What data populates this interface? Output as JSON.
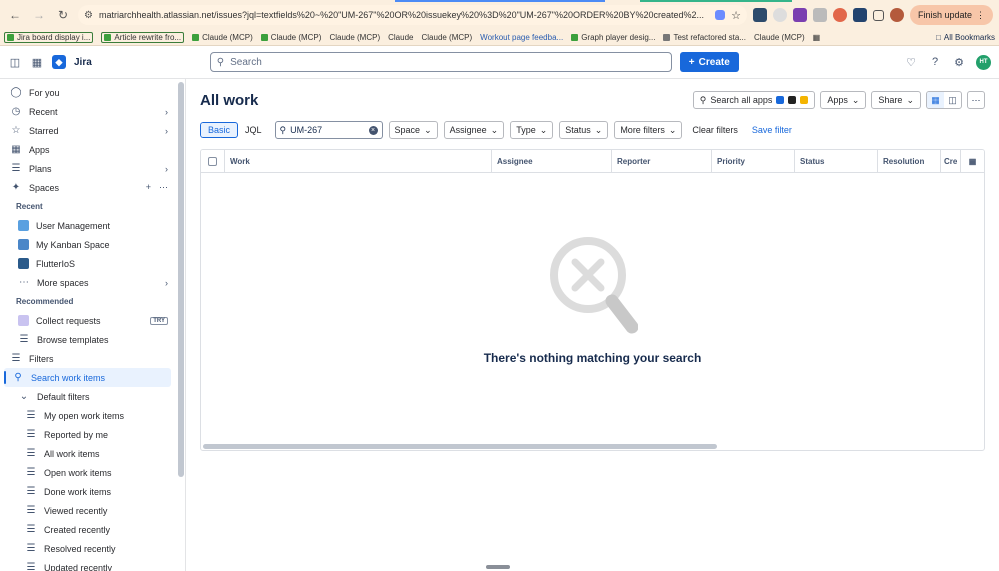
{
  "browser": {
    "url": "matriarchhealth.atlassian.net/issues?jql=textfields%20~%20\"UM-267\"%20OR%20issuekey%20%3D%20\"UM-267\"%20ORDER%20BY%20created%2...",
    "finish_update": "Finish update",
    "bookmarks": [
      "Jira board display i...",
      "Article rewrite fro...",
      "Claude (MCP)",
      "Claude (MCP)",
      "Claude (MCP)",
      "Claude",
      "Claude (MCP)",
      "Workout page feedba...",
      "Graph player desig...",
      "Test refactored sta...",
      "Claude (MCP)"
    ],
    "all_bookmarks": "All Bookmarks"
  },
  "header": {
    "app_name": "Jira",
    "search_placeholder": "Search",
    "create_label": "Create",
    "user_initials": "HT"
  },
  "sidebar": {
    "for_you": "For you",
    "recent": "Recent",
    "starred": "Starred",
    "apps": "Apps",
    "plans": "Plans",
    "spaces": "Spaces",
    "recent_heading": "Recent",
    "recent_spaces": [
      "User Management",
      "My Kanban Space",
      "FlutterIoS"
    ],
    "more_spaces": "More spaces",
    "recommended_heading": "Recommended",
    "collect_requests": "Collect requests",
    "try_badge": "TRY",
    "browse_templates": "Browse templates",
    "filters": "Filters",
    "search_work_items": "Search work items",
    "default_filters": "Default filters",
    "default_filter_items": [
      "My open work items",
      "Reported by me",
      "All work items",
      "Open work items",
      "Done work items",
      "Viewed recently",
      "Created recently",
      "Resolved recently",
      "Updated recently"
    ]
  },
  "main": {
    "title": "All work",
    "search_all_apps": "Search all apps",
    "apps_label": "Apps",
    "share_label": "Share",
    "mode_basic": "Basic",
    "mode_jql": "JQL",
    "query_value": "UM-267",
    "filters": [
      "Space",
      "Assignee",
      "Type",
      "Status",
      "More filters"
    ],
    "clear_filters": "Clear filters",
    "save_filter": "Save filter",
    "columns": [
      "Work",
      "Assignee",
      "Reporter",
      "Priority",
      "Status",
      "Resolution",
      "Cre"
    ],
    "empty_message": "There's nothing matching your search"
  }
}
